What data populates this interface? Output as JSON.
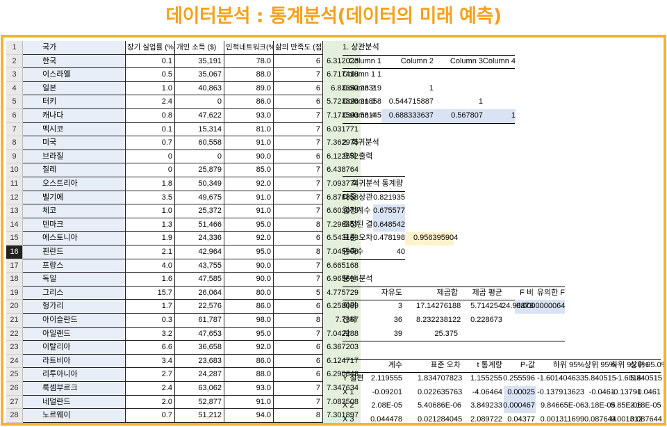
{
  "title": "데이터분석 : 통계분석(데이터의 미래 예측)",
  "headers": [
    "국가",
    "장기 실업률 (%)",
    "개인 소득 ($)",
    "인적네트워크(%)",
    "삶의 만족도 (점)"
  ],
  "rows": [
    [
      "한국",
      "0.1",
      "35,191",
      "78.0",
      "6",
      "6.312023"
    ],
    [
      "이스라엘",
      "0.5",
      "35,067",
      "88.0",
      "7",
      "6.717418"
    ],
    [
      "일본",
      "1.0",
      "40,863",
      "89.0",
      "6",
      "6.83652"
    ],
    [
      "터키",
      "2.4",
      "0",
      "86.0",
      "6",
      "5.723826"
    ],
    [
      "캐나다",
      "0.8",
      "47,622",
      "93.0",
      "7",
      "7.173503"
    ],
    [
      "멕시코",
      "0.1",
      "15,314",
      "81.0",
      "7",
      "6.031771"
    ],
    [
      "미국",
      "0.7",
      "60,558",
      "91.0",
      "7",
      "7.362975"
    ],
    [
      "브라질",
      "0",
      "0",
      "90.0",
      "6",
      "6.122552"
    ],
    [
      "칠레",
      "0",
      "25,879",
      "85.0",
      "7",
      "6.438764"
    ],
    [
      "오스트리아",
      "1.8",
      "50,349",
      "92.0",
      "7",
      "7.093774"
    ],
    [
      "벨기에",
      "3.5",
      "49,675",
      "91.0",
      "7",
      "6.878858"
    ],
    [
      "체코",
      "1.0",
      "25,372",
      "91.0",
      "7",
      "6.603073"
    ],
    [
      "덴마크",
      "1.3",
      "51,466",
      "95.0",
      "8",
      "7.296457"
    ],
    [
      "에스토니아",
      "1.9",
      "24,336",
      "92.0",
      "6",
      "6.543183"
    ],
    [
      "핀란드",
      "2.1",
      "42,964",
      "95.0",
      "8",
      "7.045906"
    ],
    [
      "프랑스",
      "4.0",
      "43,755",
      "90.0",
      "7",
      "6.665168"
    ],
    [
      "독일",
      "1.6",
      "47,585",
      "90.0",
      "7",
      "6.965694"
    ],
    [
      "그리스",
      "15.7",
      "26,064",
      "80.0",
      "5",
      "4.775729"
    ],
    [
      "헝가리",
      "1.7",
      "22,576",
      "86.0",
      "6",
      "6.258089"
    ],
    [
      "아이슬란드",
      "0.3",
      "61,787",
      "98.0",
      "8",
      "7.7367"
    ],
    [
      "아일랜드",
      "3.2",
      "47,653",
      "95.0",
      "7",
      "7.042288"
    ],
    [
      "이탈리아",
      "6.6",
      "36,658",
      "92.0",
      "6",
      "6.367203"
    ],
    [
      "라트비아",
      "3.4",
      "23,683",
      "86.0",
      "6",
      "6.124717"
    ],
    [
      "리투아니아",
      "2.7",
      "24,287",
      "88.0",
      "6",
      "6.290648"
    ],
    [
      "룩셈부르크",
      "2.4",
      "63,062",
      "93.0",
      "7",
      "7.347634"
    ],
    [
      "네덜란드",
      "2.0",
      "52,877",
      "91.0",
      "7",
      "7.083508"
    ],
    [
      "노르웨이",
      "0.7",
      "51,212",
      "94.0",
      "8",
      "7.301897"
    ]
  ],
  "row_numbers": [
    "1",
    "2",
    "3",
    "4",
    "5",
    "6",
    "7",
    "8",
    "9",
    "10",
    "11",
    "12",
    "13",
    "14",
    "15",
    "16",
    "17",
    "18",
    "19",
    "20",
    "21",
    "22",
    "23",
    "24",
    "25",
    "26",
    "27",
    "28"
  ],
  "corr": {
    "heading": "1. 상관분석",
    "cols": [
      "Column 1",
      "Column 2",
      "Column 3",
      "Column 4"
    ],
    "rows": [
      [
        "Column 1",
        "1",
        "",
        "",
        ""
      ],
      [
        "Column 2",
        "-0.28319",
        "1",
        "",
        ""
      ],
      [
        "Column 3",
        "-0.21858",
        "0.544715887",
        "1",
        ""
      ],
      [
        "Column 4",
        "-0.58145",
        "0.688333637",
        "0.567807",
        "1"
      ]
    ]
  },
  "reg": {
    "heading": "2. 회귀분석",
    "summary": "요약 출력",
    "stat_title": "회귀분석 통계량",
    "stats": [
      [
        "다중 상관",
        "0.821935"
      ],
      [
        "결정계수",
        "0.675577"
      ],
      [
        "조정된 결",
        "0.648542"
      ],
      [
        "표준 오차",
        "0.478198"
      ],
      [
        "관측수",
        "40"
      ]
    ],
    "extra": "0.956395904"
  },
  "anova": {
    "heading": "분산 분석",
    "cols": [
      "자유도",
      "제곱합",
      "제곱 평균",
      "F 비",
      "유의한 F"
    ],
    "rows": [
      [
        "회귀",
        "3",
        "17.14276188",
        "5.714254",
        "24.98873",
        "0.0000000064"
      ],
      [
        "잔차",
        "36",
        "8.232238122",
        "0.228673",
        "",
        ""
      ],
      [
        "계",
        "39",
        "25.375",
        "",
        "",
        ""
      ]
    ]
  },
  "coef": {
    "cols": [
      "계수",
      "표준 오차",
      "t 통계량",
      "P-값",
      "하위 95%",
      "상위 95%",
      "하위 95.0%",
      "상위 95.0%"
    ],
    "rows": [
      [
        "Y 절편",
        "2.119555",
        "1.834707823",
        "1.155255",
        "0.255596",
        "-1.601404633",
        "5.840515",
        "-1.6014",
        "5.840515"
      ],
      [
        "X 1",
        "-0.09201",
        "0.022635763",
        "-4.06464",
        "0.00025",
        "-0.137913623",
        "-0.0461",
        "-0.13791",
        "-0.0461"
      ],
      [
        "X 2",
        "2.08E-05",
        "5.40686E-06",
        "3.849233",
        "0.000467",
        "9.84665E-06",
        "3.18E-05",
        "9.85E-06",
        "3.18E-05"
      ],
      [
        "X 3",
        "0.044478",
        "0.021284045",
        "2.089722",
        "0.04377",
        "0.001311699",
        "0.087644",
        "0.001312",
        "0.087644"
      ]
    ]
  }
}
